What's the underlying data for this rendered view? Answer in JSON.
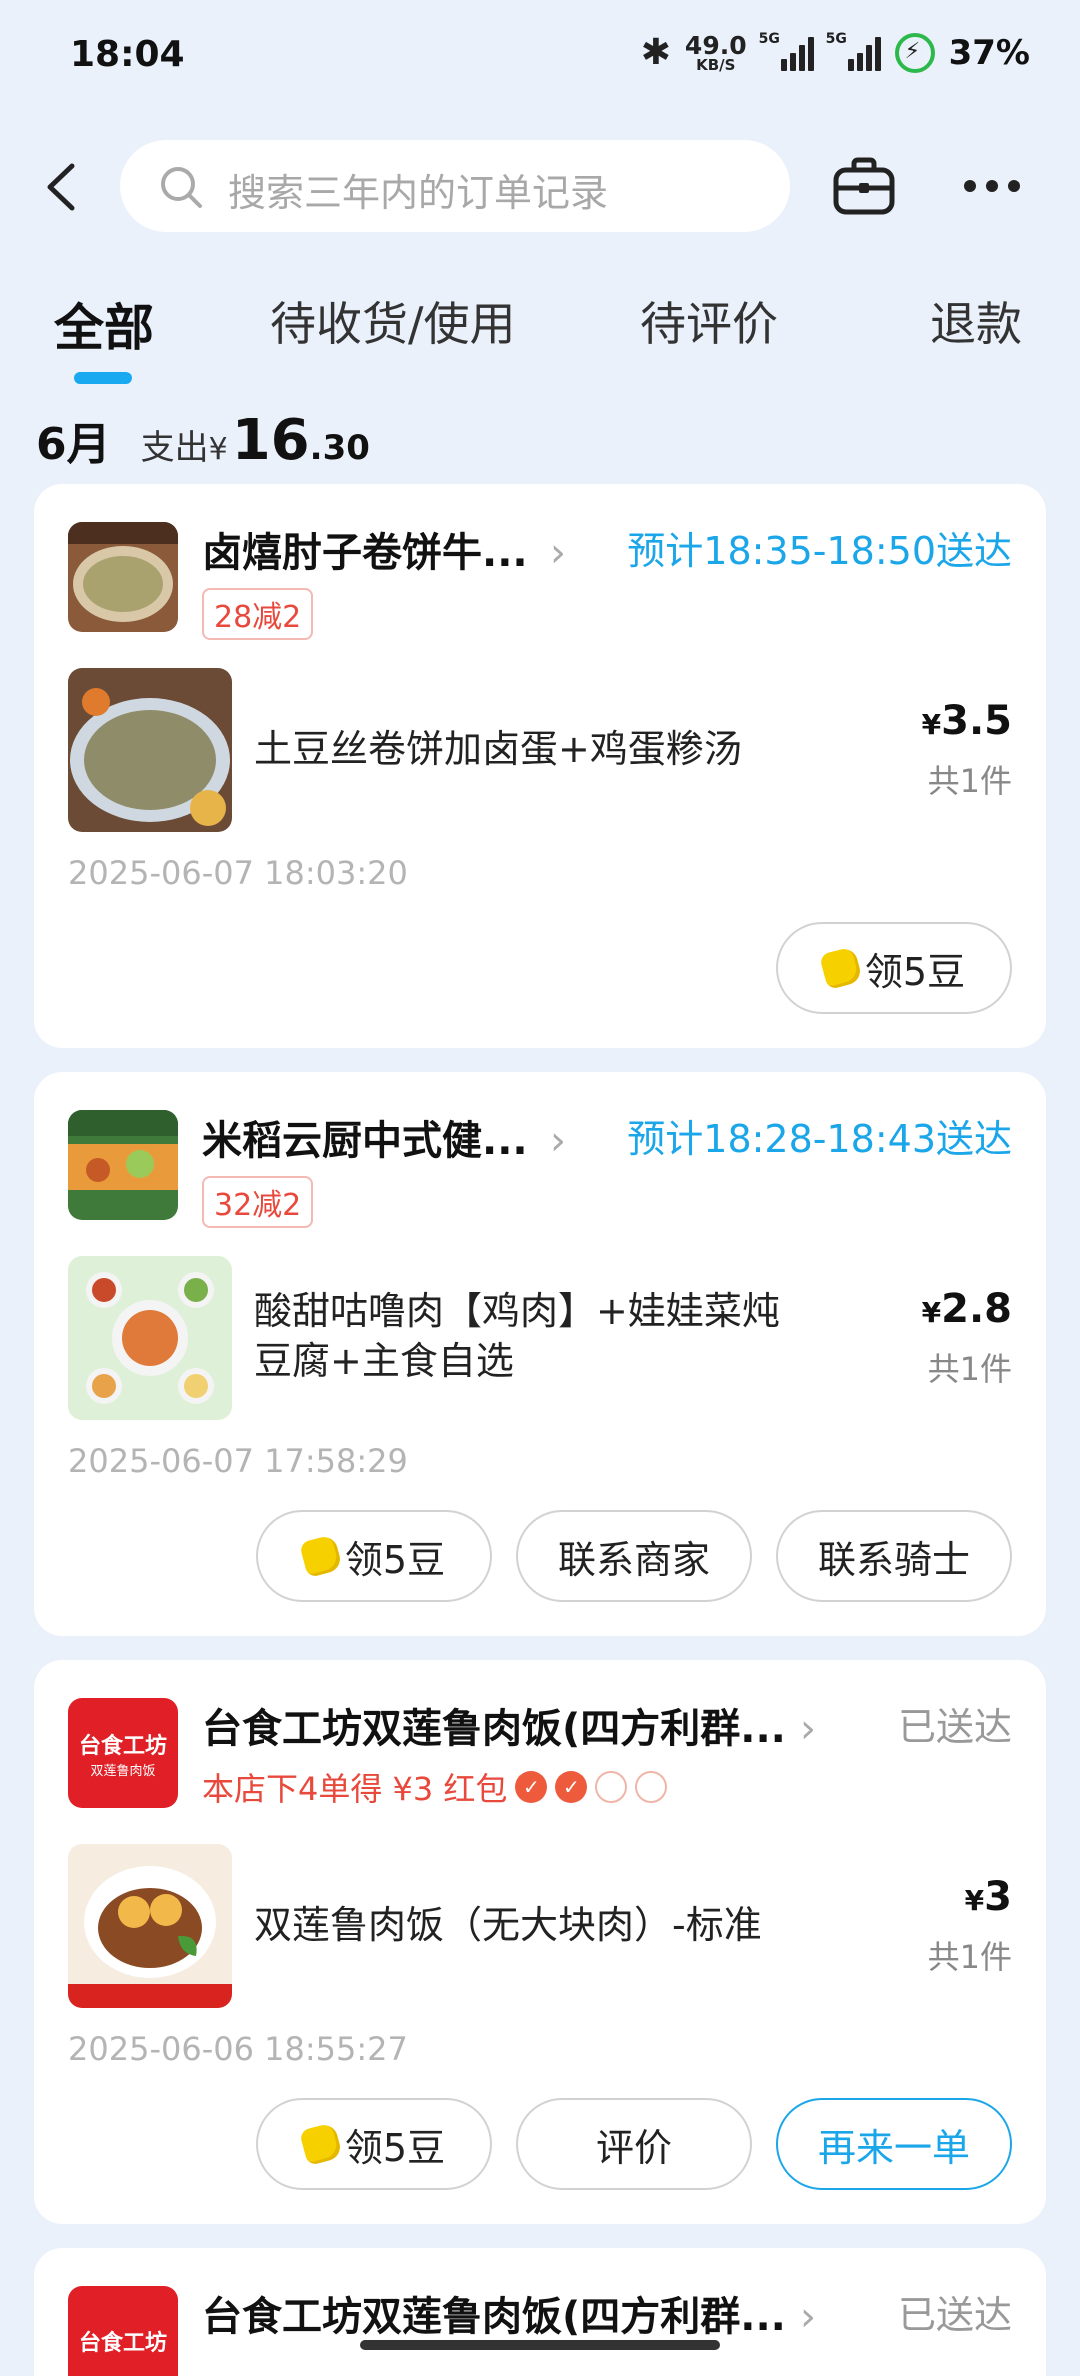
{
  "status_bar": {
    "time": "18:04",
    "net_speed": "49.0",
    "net_unit": "KB/S",
    "sig1": "5G",
    "sig2": "5G",
    "battery": "37%"
  },
  "header": {
    "search_placeholder": "搜索三年内的订单记录"
  },
  "tabs": [
    {
      "label": "全部",
      "active": true
    },
    {
      "label": "待收货/使用",
      "active": false
    },
    {
      "label": "待评价",
      "active": false
    },
    {
      "label": "退款",
      "active": false
    }
  ],
  "summary": {
    "month": "6月",
    "spend_label": "支出",
    "currency": "¥",
    "spend_int": "16",
    "spend_dec": ".30"
  },
  "orders": [
    {
      "shop": "卤熺肘子卷饼牛...",
      "status": "预计18:35-18:50送达",
      "promo": "28减2",
      "item": "土豆丝卷饼加卤蛋+鸡蛋糁汤",
      "currency": "¥",
      "price": "3.5",
      "qty": "共1件",
      "time": "2025-06-07 18:03:20",
      "buttons": [
        "领5豆"
      ]
    },
    {
      "shop": "米稻云厨中式健...",
      "status": "预计18:28-18:43送达",
      "promo": "32减2",
      "item": "酸甜咕噜肉【鸡肉】+娃娃菜炖豆腐+主食自选",
      "currency": "¥",
      "price": "2.8",
      "qty": "共1件",
      "time": "2025-06-07 17:58:29",
      "buttons": [
        "领5豆",
        "联系商家",
        "联系骑士"
      ]
    },
    {
      "shop": "台食工坊双莲鲁肉饭(四方利群...",
      "status": "已送达",
      "promo": "本店下4单得 ¥3 红包",
      "item": "双莲鲁肉饭（无大块肉）-标准",
      "currency": "¥",
      "price": "3",
      "qty": "共1件",
      "time": "2025-06-06 18:55:27",
      "buttons": [
        "领5豆",
        "评价",
        "再来一单"
      ],
      "logo_text_1": "台食工坊",
      "logo_text_2": "双莲鲁肉饭"
    },
    {
      "shop": "台食工坊双莲鲁肉饭(四方利群...",
      "status": "已送达",
      "logo_text_1": "台食工坊"
    }
  ],
  "colors": {
    "accent": "#1aa6e8",
    "promo_red": "#e8493c",
    "background": "#eaf1fb"
  }
}
